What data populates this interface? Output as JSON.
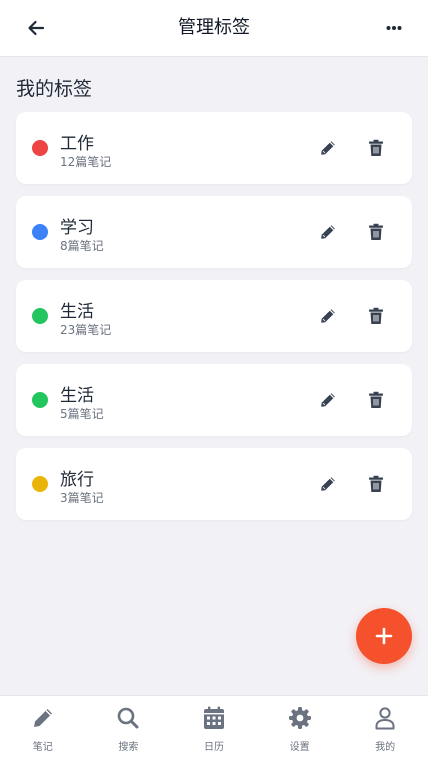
{
  "header": {
    "title": "管理标签",
    "back_icon": "arrow-left-icon",
    "more_icon": "ellipsis-icon"
  },
  "section_title": "我的标签",
  "tags": [
    {
      "name": "工作",
      "count": "12篇笔记",
      "color": "#ef4444"
    },
    {
      "name": "学习",
      "count": "8篇笔记",
      "color": "#3b82f6"
    },
    {
      "name": "生活",
      "count": "23篇笔记",
      "color": "#22c55e"
    },
    {
      "name": "生活",
      "count": "5篇笔记",
      "color": "#22c55e"
    },
    {
      "name": "旅行",
      "count": "3篇笔记",
      "color": "#eab308"
    }
  ],
  "tag_actions": {
    "edit_icon": "pencil-icon",
    "delete_icon": "trash-icon"
  },
  "fab": {
    "icon": "plus-icon",
    "color": "#f4512c"
  },
  "tabbar": {
    "items": [
      {
        "label": "笔记",
        "icon": "pencil-icon"
      },
      {
        "label": "搜索",
        "icon": "search-icon"
      },
      {
        "label": "日历",
        "icon": "calendar-icon"
      },
      {
        "label": "设置",
        "icon": "gear-icon"
      },
      {
        "label": "我的",
        "icon": "user-icon"
      }
    ]
  }
}
